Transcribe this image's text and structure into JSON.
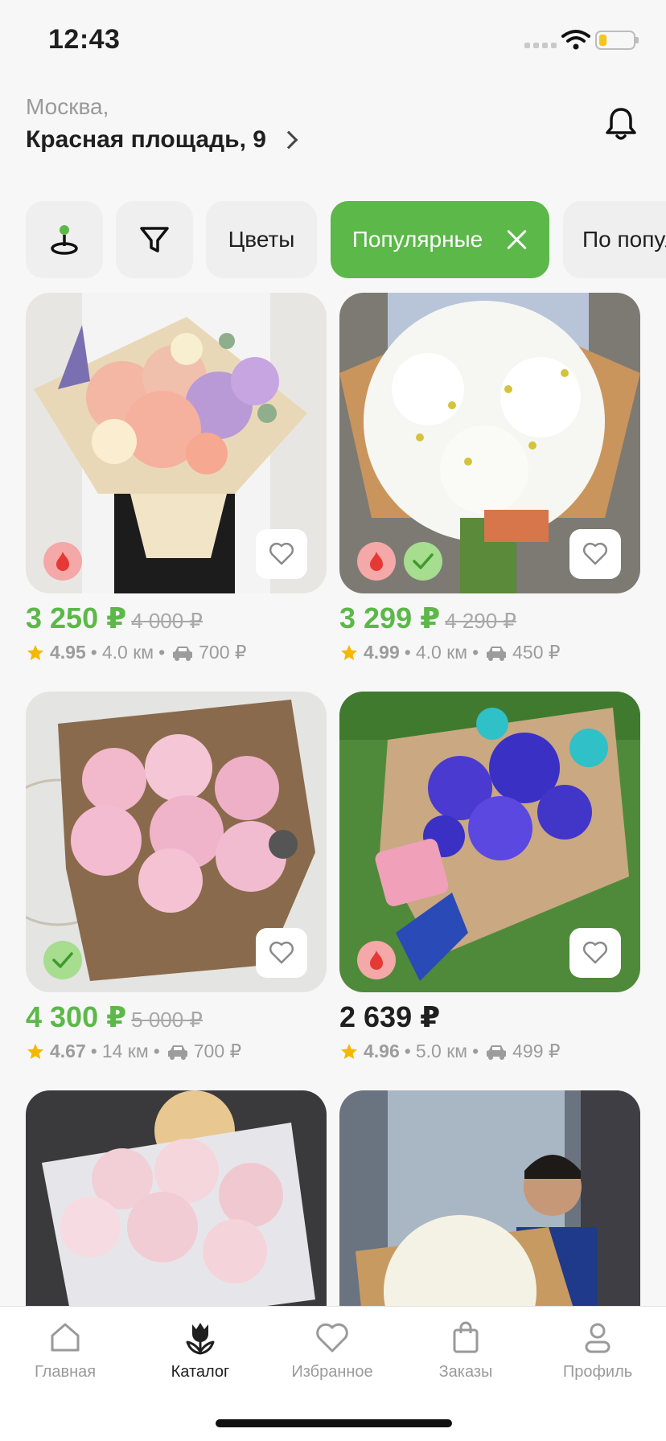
{
  "status_bar": {
    "time": "12:43"
  },
  "header": {
    "city": "Москва,",
    "address": "Красная площадь, 9"
  },
  "chips": {
    "flowers": "Цветы",
    "popular": "Популярные",
    "sort": "По популярности"
  },
  "products": [
    {
      "price": "3 250 ₽",
      "old_price": "4 000 ₽",
      "rating": "4.95",
      "distance": "4.0 км",
      "delivery": "700 ₽"
    },
    {
      "price": "3 299 ₽",
      "old_price": "4 290 ₽",
      "rating": "4.99",
      "distance": "4.0 км",
      "delivery": "450 ₽"
    },
    {
      "price": "4 300 ₽",
      "old_price": "5 000 ₽",
      "rating": "4.67",
      "distance": "14 км",
      "delivery": "700 ₽"
    },
    {
      "price": "2 639 ₽",
      "old_price": "",
      "rating": "4.96",
      "distance": "5.0 км",
      "delivery": "499 ₽"
    }
  ],
  "tabbar": {
    "home": "Главная",
    "catalog": "Каталог",
    "favorites": "Избранное",
    "orders": "Заказы",
    "profile": "Профиль"
  },
  "colors": {
    "accent": "#5cb849",
    "badge_fire": "#f4a8a8",
    "badge_check": "#a6dd8f",
    "star": "#f5b800"
  }
}
